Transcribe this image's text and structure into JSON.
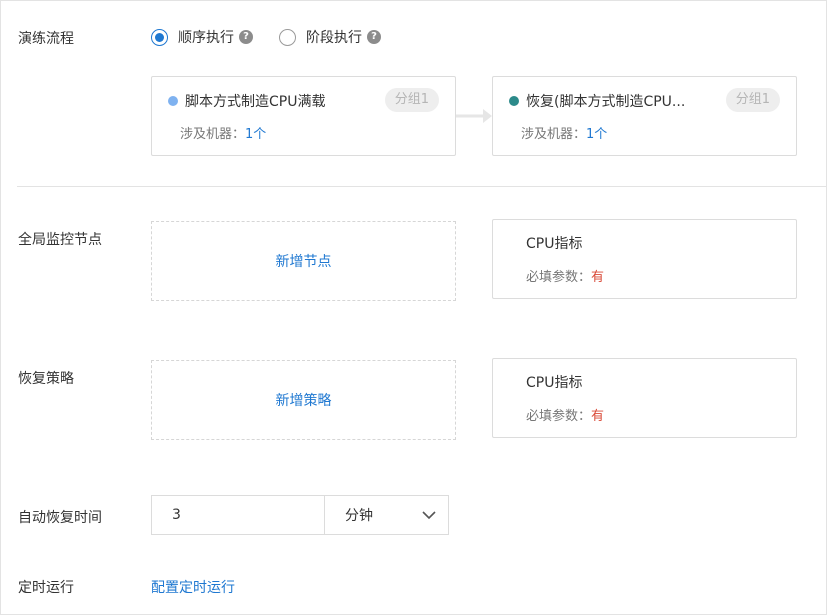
{
  "flow": {
    "label": "演练流程",
    "options": [
      {
        "label": "顺序执行",
        "checked": true
      },
      {
        "label": "阶段执行",
        "checked": false
      }
    ],
    "help_icon": "?"
  },
  "steps": [
    {
      "title": "脚本方式制造CPU满载",
      "group": "分组1",
      "machines_label": "涉及机器：",
      "machines_value": "1个",
      "dot_color": "#7fb2f0"
    },
    {
      "title": "恢复(脚本方式制造CPU...",
      "group": "分组1",
      "machines_label": "涉及机器：",
      "machines_value": "1个",
      "dot_color": "#2c8a8a"
    }
  ],
  "monitor": {
    "label": "全局监控节点",
    "add_label": "新增节点",
    "metric": {
      "title": "CPU指标",
      "required_label": "必填参数：",
      "required_value": "有"
    }
  },
  "recovery": {
    "label": "恢复策略",
    "add_label": "新增策略",
    "metric": {
      "title": "CPU指标",
      "required_label": "必填参数：",
      "required_value": "有"
    }
  },
  "auto_recover": {
    "label": "自动恢复时间",
    "value": "3",
    "unit": "分钟"
  },
  "schedule": {
    "label": "定时运行",
    "link_label": "配置定时运行"
  },
  "colors": {
    "accent": "#1f78d1",
    "required": "#d94a38"
  }
}
